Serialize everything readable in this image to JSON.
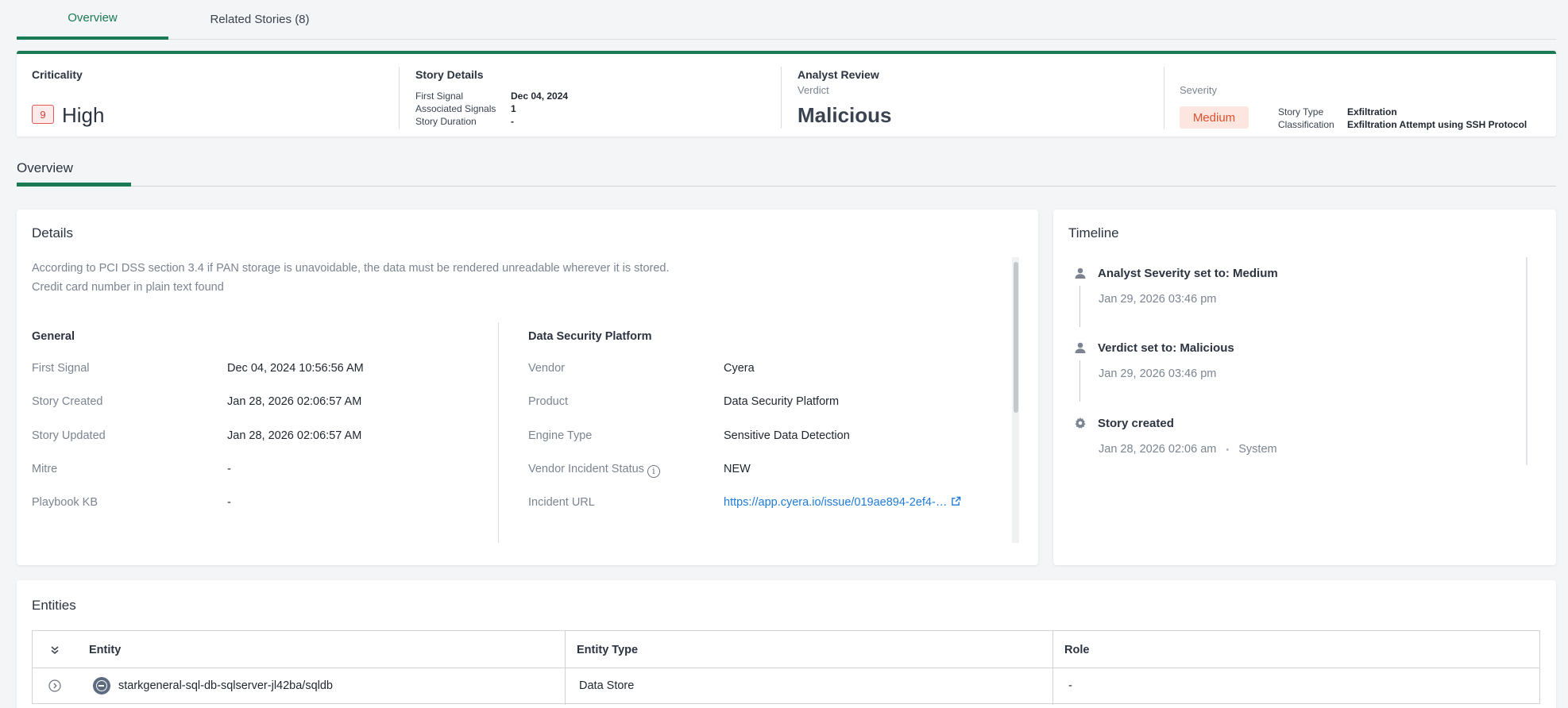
{
  "top_tabs": {
    "overview": "Overview",
    "related": "Related Stories (8)"
  },
  "summary": {
    "criticality": {
      "title": "Criticality",
      "score": "9",
      "level": "High"
    },
    "story_details": {
      "title": "Story Details",
      "first_signal_label": "First Signal",
      "first_signal_value": "Dec 04, 2024",
      "associated_label": "Associated Signals",
      "associated_value": "1",
      "duration_label": "Story Duration",
      "duration_value": "-"
    },
    "analyst_review": {
      "title": "Analyst Review",
      "verdict_label": "Verdict",
      "verdict_value": "Malicious"
    },
    "severity": {
      "label": "Severity",
      "value": "Medium",
      "story_type_label": "Story Type",
      "story_type_value": "Exfiltration",
      "classification_label": "Classification",
      "classification_value": "Exfiltration Attempt using SSH Protocol"
    }
  },
  "sub_tabs": {
    "overview": "Overview"
  },
  "details": {
    "title": "Details",
    "description_line1": "According to PCI DSS section 3.4 if PAN storage is unavoidable, the data must be rendered unreadable wherever it is stored.",
    "description_line2": "Credit card number in plain text found",
    "general": {
      "title": "General",
      "rows": [
        {
          "label": "First Signal",
          "value": "Dec 04, 2024 10:56:56 AM"
        },
        {
          "label": "Story Created",
          "value": "Jan 28, 2026 02:06:57 AM"
        },
        {
          "label": "Story Updated",
          "value": "Jan 28, 2026 02:06:57 AM"
        },
        {
          "label": "Mitre",
          "value": "-"
        },
        {
          "label": "Playbook KB",
          "value": "-"
        }
      ]
    },
    "dsp": {
      "title": "Data Security Platform",
      "rows": [
        {
          "label": "Vendor",
          "value": "Cyera"
        },
        {
          "label": "Product",
          "value": "Data Security Platform"
        },
        {
          "label": "Engine Type",
          "value": "Sensitive Data Detection"
        },
        {
          "label": "Vendor Incident Status",
          "value": "NEW"
        },
        {
          "label": "Incident URL",
          "value": "https://app.cyera.io/issue/019ae894-2ef4-…"
        }
      ]
    }
  },
  "timeline": {
    "title": "Timeline",
    "events": [
      {
        "title": "Analyst Severity set to: Medium",
        "time": "Jan 29, 2026 03:46 pm",
        "icon": "user-icon"
      },
      {
        "title": "Verdict set to: Malicious",
        "time": "Jan 29, 2026 03:46 pm",
        "icon": "user-icon"
      },
      {
        "title": "Story created",
        "time": "Jan 28, 2026 02:06 am",
        "actor": "System",
        "separator": "•",
        "icon": "gear-icon"
      }
    ]
  },
  "entities": {
    "title": "Entities",
    "headers": {
      "entity": "Entity",
      "type": "Entity Type",
      "role": "Role"
    },
    "rows": [
      {
        "entity": "starkgeneral-sql-db-sqlserver-jl42ba/sqldb",
        "type": "Data Store",
        "role": "-"
      }
    ]
  },
  "colors": {
    "accent": "#1a7a53",
    "critical": "#d23b3b",
    "severity_medium": "#e0502c",
    "link": "#1f7ad6"
  }
}
